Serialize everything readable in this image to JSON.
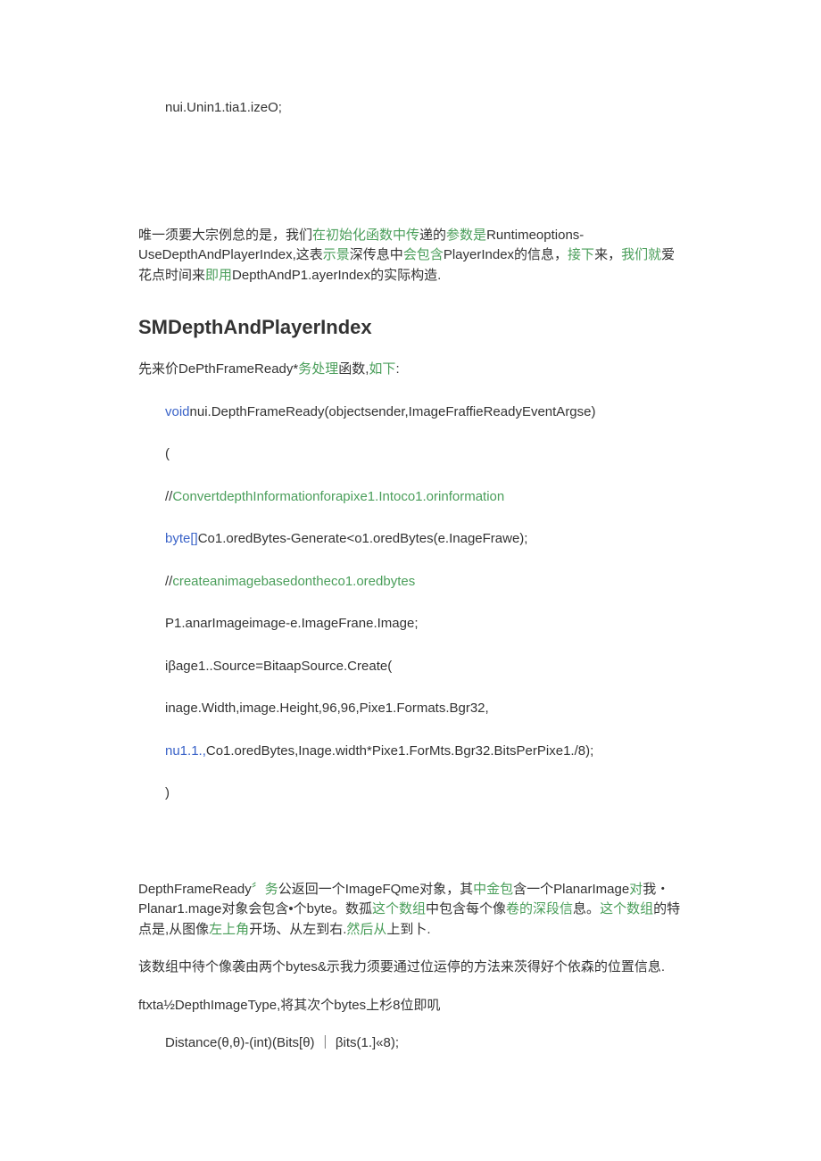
{
  "topCode": "nui.Unin1.tia1.izeO;",
  "para1": {
    "p1": "唯一须要大宗例怠的是，我们",
    "g1": "在初始化函数中传",
    "p2": "递的",
    "g2": "参数是",
    "p3": "Runtimeoptions-UseDepthAndPlayerIndex,这表",
    "g3": "示景",
    "p4": "深传息中",
    "g4": "会包含",
    "p5": "PlayerIndex的信息，",
    "g5": "接下",
    "p6": "来，",
    "g6": "我们就",
    "p7": "爱花点时间来",
    "g7": "即用",
    "p8": "DepthAndP1.ayerIndex的实际构造."
  },
  "heading": "SMDepthAndPlayerIndex",
  "para2": {
    "p1": "先来价DePthFrameReady*",
    "g1": "务处理",
    "p2": "函数,",
    "g2": "如下",
    "p3": ":"
  },
  "code": {
    "l1a": "void",
    "l1b": "nui.DepthFrameReady(objectsender,ImageFraffieReadyEventArgse)",
    "l2": "(",
    "l3a": "//",
    "l3b": "ConvertdepthInformationforapixe1.Intoco1.orinformation",
    "l4a": "byte[]",
    "l4b": "Co1.oredBytes-Generate<o1.oredBytes(e.InageFrawe);",
    "l5a": "//",
    "l5b": "createanimagebasedontheco1.oredbytes",
    "l6": "P1.anarImageimage-e.ImageFrane.Image;",
    "l7": "iβage1..Source=BitaapSource.Create(",
    "l8": "inage.Width,image.Height,96,96,Pixe1.Formats.Bgr32,",
    "l9a": "nu1.1.,",
    "l9b": "Co1.oredBytes,Inage.width*Pixe1.ForMts.Bgr32.BitsPerPixe1./8);",
    "l10": ")"
  },
  "para3": {
    "p1": "DepthFrameReady",
    "g1": "〞务",
    "p2": "公返回一个ImageFQme对象，其",
    "g2": "中金包",
    "p3": "含一个PlanarImage",
    "g3": "对",
    "p4": "我・Planar1.mage对象会包含•个byte。数孤",
    "g4": "这个数组",
    "p5": "中包含每个像",
    "g5": "卷的深段信",
    "p6": "息。",
    "g6": "这个数组",
    "p7": "的特点是,从图像",
    "g7": "左上角",
    "p8": "开场、从左到右.",
    "g8": "然后从",
    "p9": "上到卜."
  },
  "para4": "该数组中待个像袭由两个bytes&示我力须要通过位运停的方法来茨得好个依森的位置信息.",
  "para5": "ftxta½DepthImageType,将其次个bytes上杉8位即叽",
  "distanceCode": "Distance(θ,θ)-(int)(Bits[θ) ｜ βits(1.]«8);"
}
